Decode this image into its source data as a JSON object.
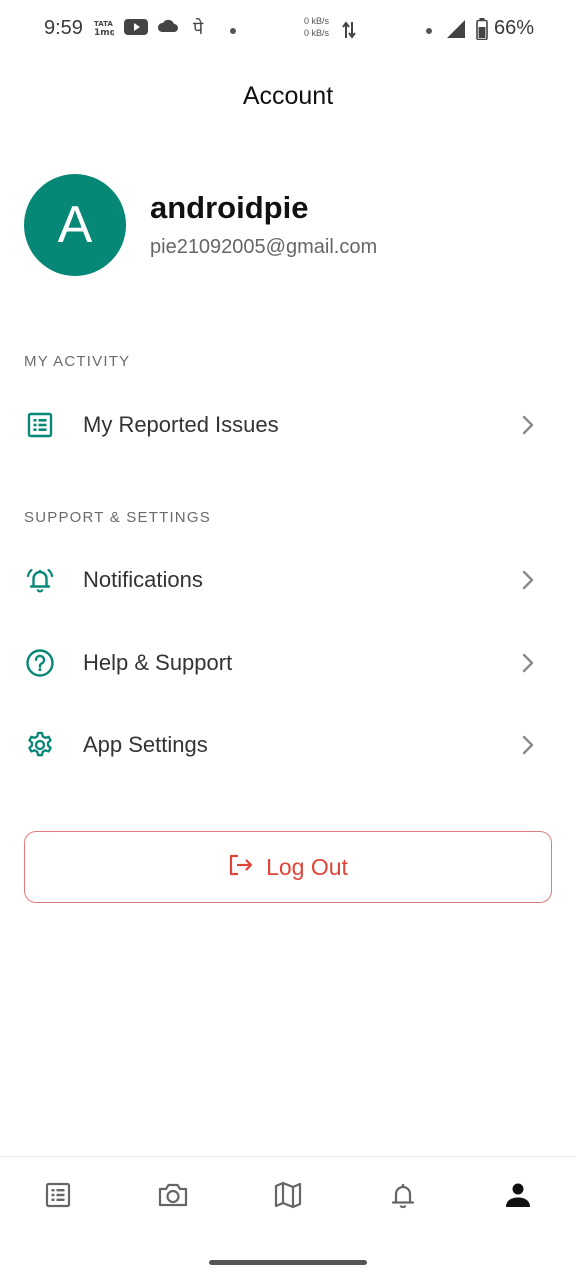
{
  "status_bar": {
    "time": "9:59",
    "net_up": "0 kB/s",
    "net_down": "0 kB/s",
    "battery": "66%"
  },
  "header": {
    "title": "Account"
  },
  "profile": {
    "avatar_letter": "A",
    "name": "androidpie",
    "email": "pie21092005@gmail.com",
    "avatar_color": "#078776"
  },
  "sections": {
    "activity": {
      "title": "MY ACTIVITY",
      "items": [
        {
          "label": "My Reported Issues",
          "icon": "list-icon"
        }
      ]
    },
    "support": {
      "title": "SUPPORT & SETTINGS",
      "items": [
        {
          "label": "Notifications",
          "icon": "bell-ringing-icon"
        },
        {
          "label": "Help & Support",
          "icon": "help-circle-icon"
        },
        {
          "label": "App Settings",
          "icon": "gear-icon"
        }
      ]
    }
  },
  "logout": {
    "label": "Log Out",
    "color": "#e04438"
  },
  "bottom_nav": {
    "items": [
      {
        "icon": "list-icon"
      },
      {
        "icon": "camera-icon"
      },
      {
        "icon": "map-icon"
      },
      {
        "icon": "bell-icon"
      },
      {
        "icon": "person-icon",
        "active": true
      }
    ]
  },
  "colors": {
    "accent": "#078776",
    "danger": "#e04438"
  }
}
